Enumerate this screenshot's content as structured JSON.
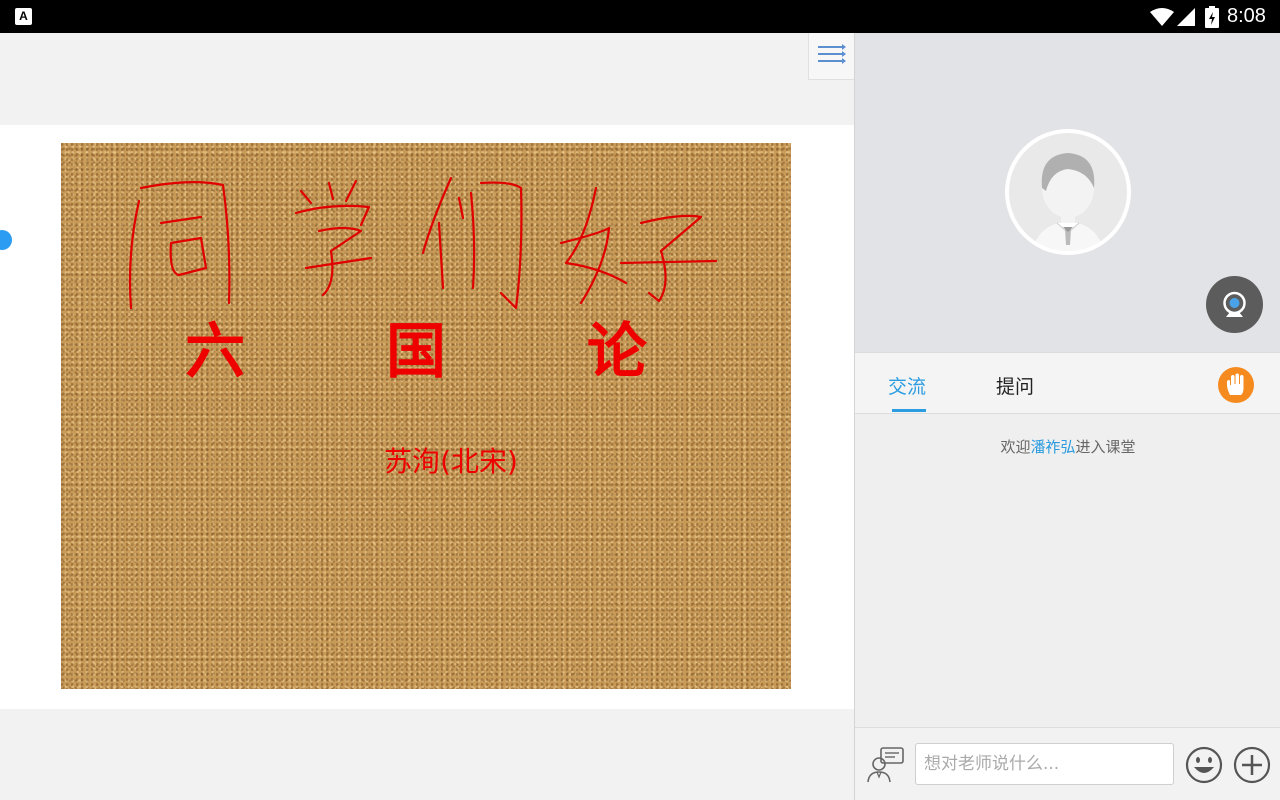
{
  "statusbar": {
    "time": "8:08",
    "notification_glyph": "A"
  },
  "whiteboard": {
    "title": "六 国 论",
    "author": "苏洵(北宋)",
    "handwriting": "同学们好",
    "ink_color": "#ee0000"
  },
  "chat_panel": {
    "tabs": [
      {
        "label": "交流",
        "active": true
      },
      {
        "label": "提问",
        "active": false
      }
    ],
    "welcome": {
      "prefix": "欢迎",
      "name": "潘祚弘",
      "suffix": "进入课堂"
    },
    "input_placeholder": "想对老师说什么...",
    "accent_color": "#2b9ce0",
    "hand_button_color": "#f58a1f"
  }
}
